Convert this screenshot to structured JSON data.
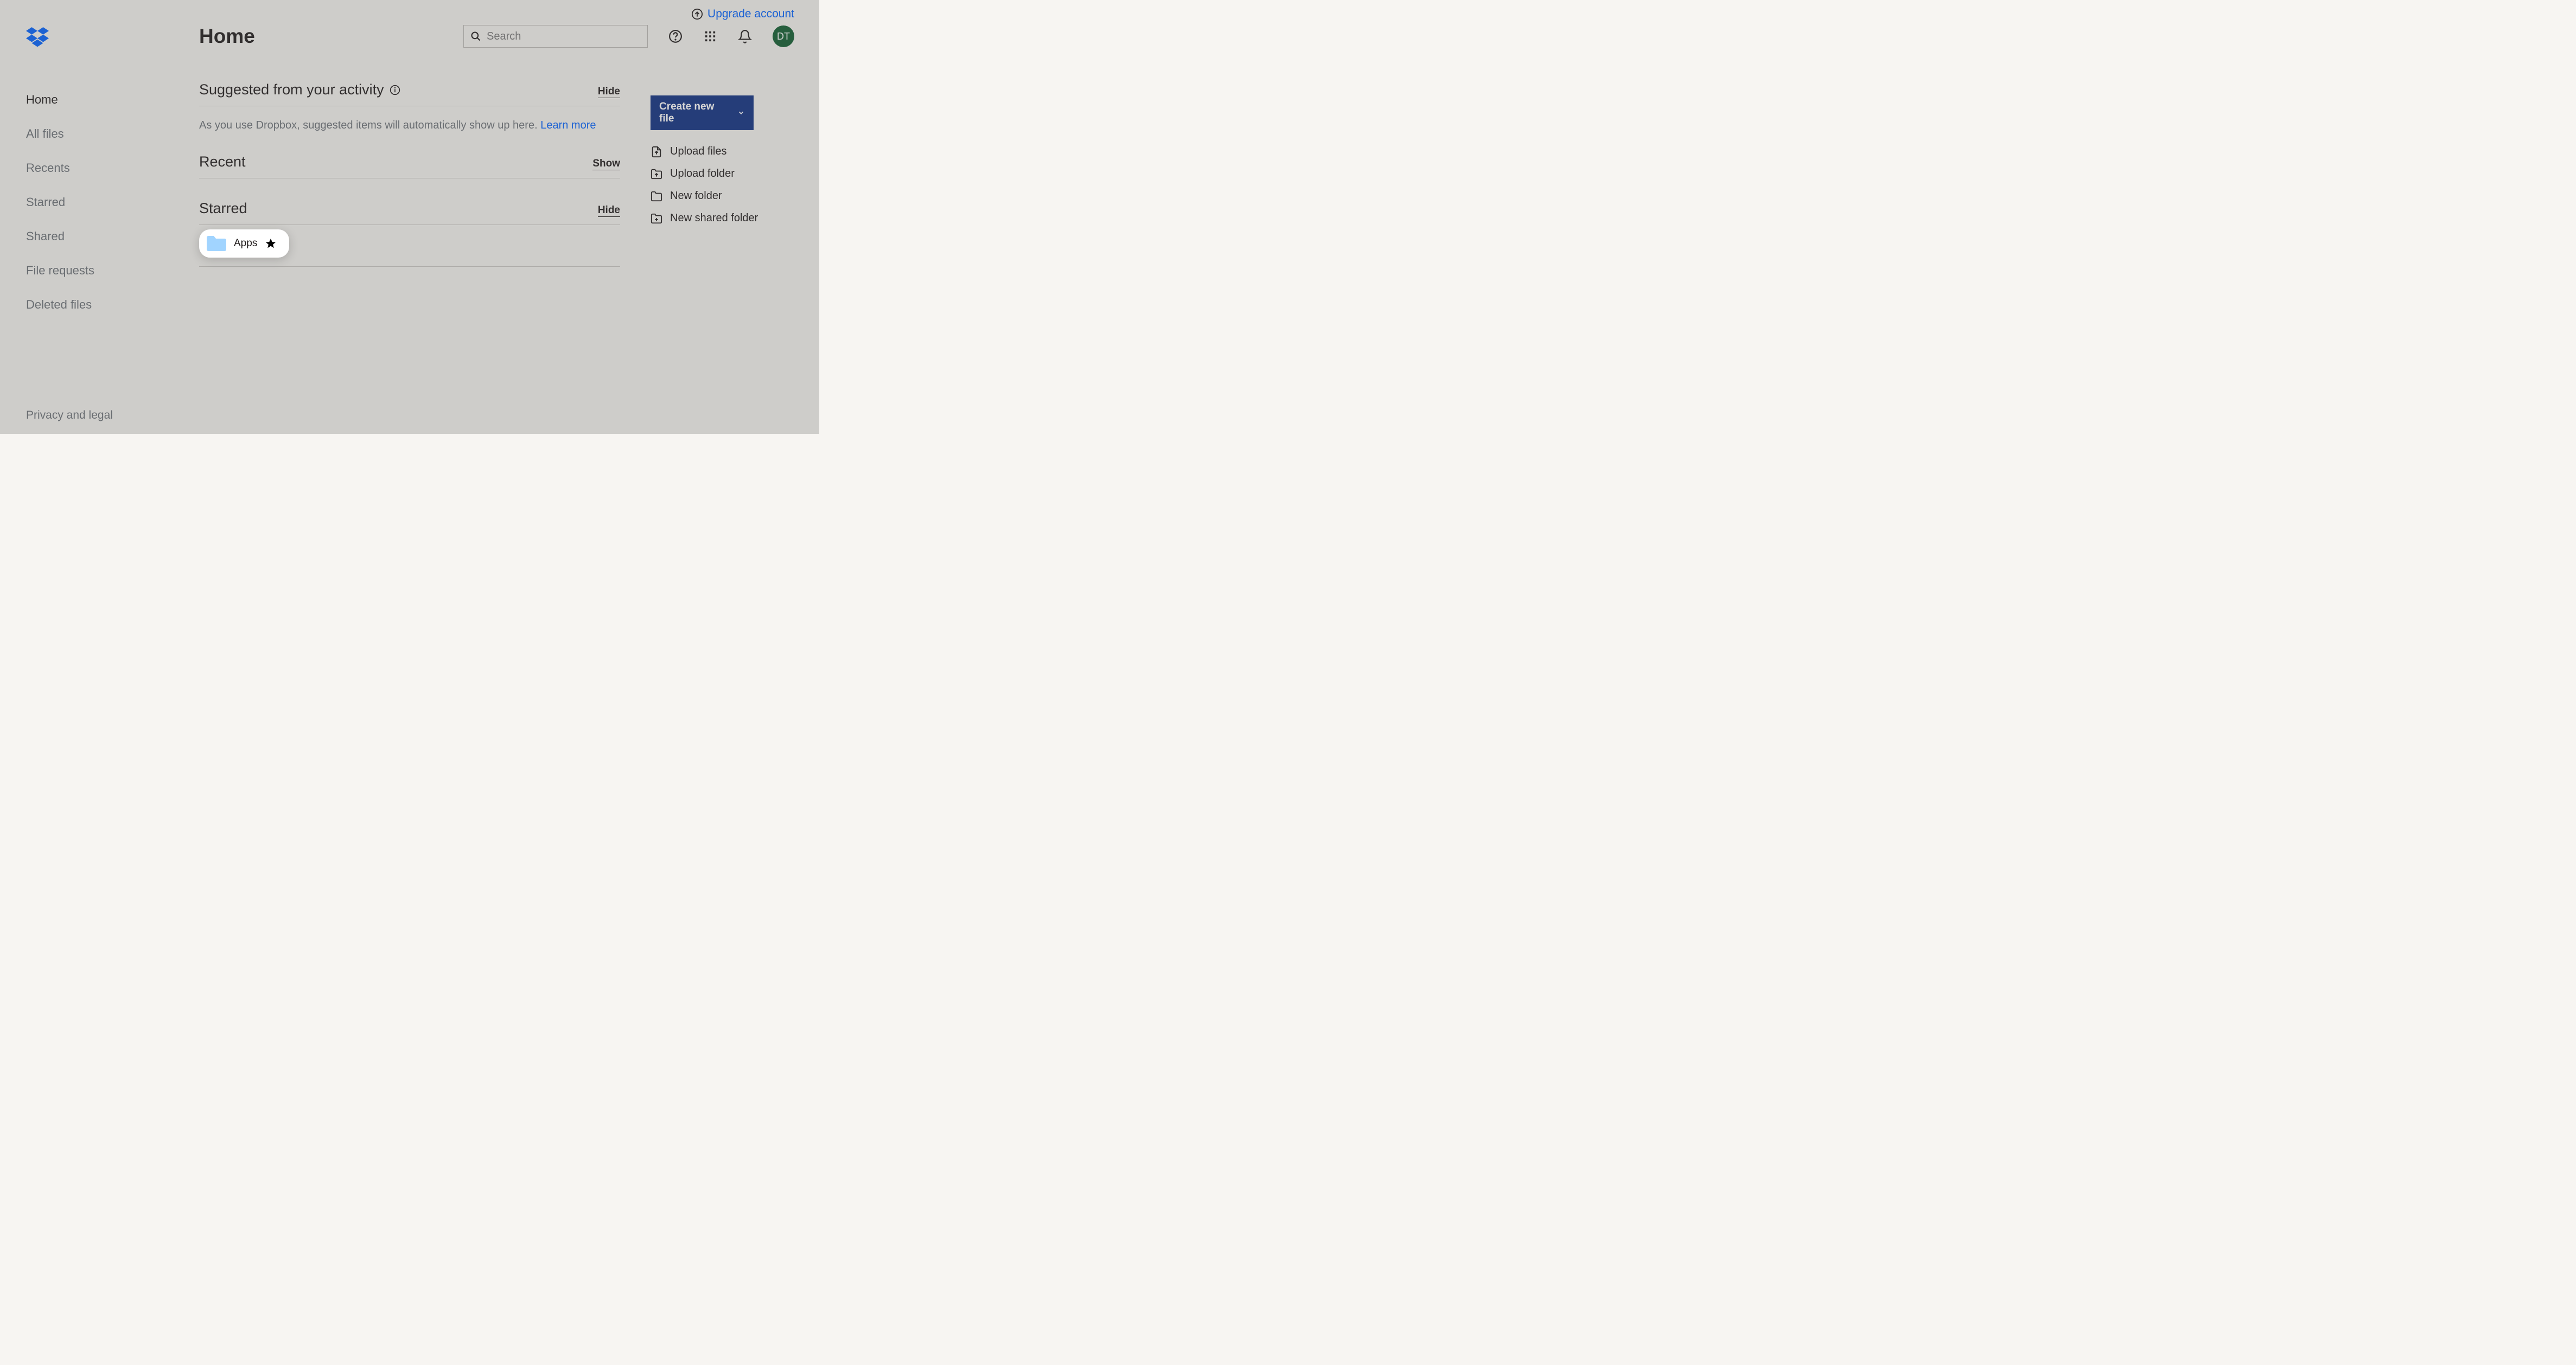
{
  "sidebar": {
    "nav": [
      {
        "label": "Home"
      },
      {
        "label": "All files"
      },
      {
        "label": "Recents"
      },
      {
        "label": "Starred"
      },
      {
        "label": "Shared"
      },
      {
        "label": "File requests"
      },
      {
        "label": "Deleted files"
      }
    ],
    "footer": "Privacy and legal"
  },
  "header": {
    "upgrade": "Upgrade account",
    "title": "Home",
    "search_placeholder": "Search",
    "avatar": "DT"
  },
  "suggested": {
    "title": "Suggested from your activity",
    "toggle": "Hide",
    "description": "As you use Dropbox, suggested items will automatically show up here. ",
    "link": "Learn more"
  },
  "recent": {
    "title": "Recent",
    "toggle": "Show"
  },
  "starred": {
    "title": "Starred",
    "toggle": "Hide",
    "items": [
      {
        "name": "Apps"
      }
    ]
  },
  "actions": {
    "create": "Create new file",
    "items": [
      {
        "label": "Upload files",
        "icon": "file-upload"
      },
      {
        "label": "Upload folder",
        "icon": "folder-upload"
      },
      {
        "label": "New folder",
        "icon": "folder"
      },
      {
        "label": "New shared folder",
        "icon": "folder-plus"
      }
    ]
  }
}
